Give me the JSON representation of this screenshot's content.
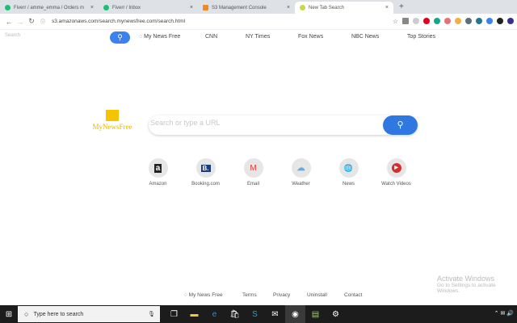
{
  "tabs": [
    {
      "title": "Fiverr / amme_emma / Orders m",
      "color": "#1dbf73"
    },
    {
      "title": "Fiverr / Inbox",
      "color": "#1dbf73"
    },
    {
      "title": "S3 Management Console",
      "color": "#f08a24"
    },
    {
      "title": "New Tab Search",
      "color": "#c8d84a",
      "active": true
    }
  ],
  "address": {
    "url": "s3.amazonaws.com/search.mynewsfree.com/search.html"
  },
  "topnav": {
    "search_placeholder": "Search",
    "brand": "My News Free",
    "links": [
      "CNN",
      "NY Times",
      "Fox News",
      "NBC News",
      "Top Stories"
    ]
  },
  "logo": {
    "text": "MyNewsFree"
  },
  "main_search": {
    "placeholder": "Search or type a URL"
  },
  "tiles": [
    {
      "label": "Amazon",
      "glyph": "a"
    },
    {
      "label": "Booking.com",
      "glyph": "B."
    },
    {
      "label": "Email",
      "glyph": "M"
    },
    {
      "label": "Weather",
      "glyph": "☁"
    },
    {
      "label": "News",
      "glyph": "🌐"
    },
    {
      "label": "Watch Videos",
      "glyph": "▶"
    }
  ],
  "footer": {
    "brand": "My News Free",
    "links": [
      "Terms",
      "Privacy",
      "Uninstall",
      "Contact"
    ]
  },
  "watermark": {
    "line1": "Activate Windows",
    "line2": "Go to Settings to activate Windows."
  },
  "taskbar": {
    "search_placeholder": "Type here to search"
  }
}
